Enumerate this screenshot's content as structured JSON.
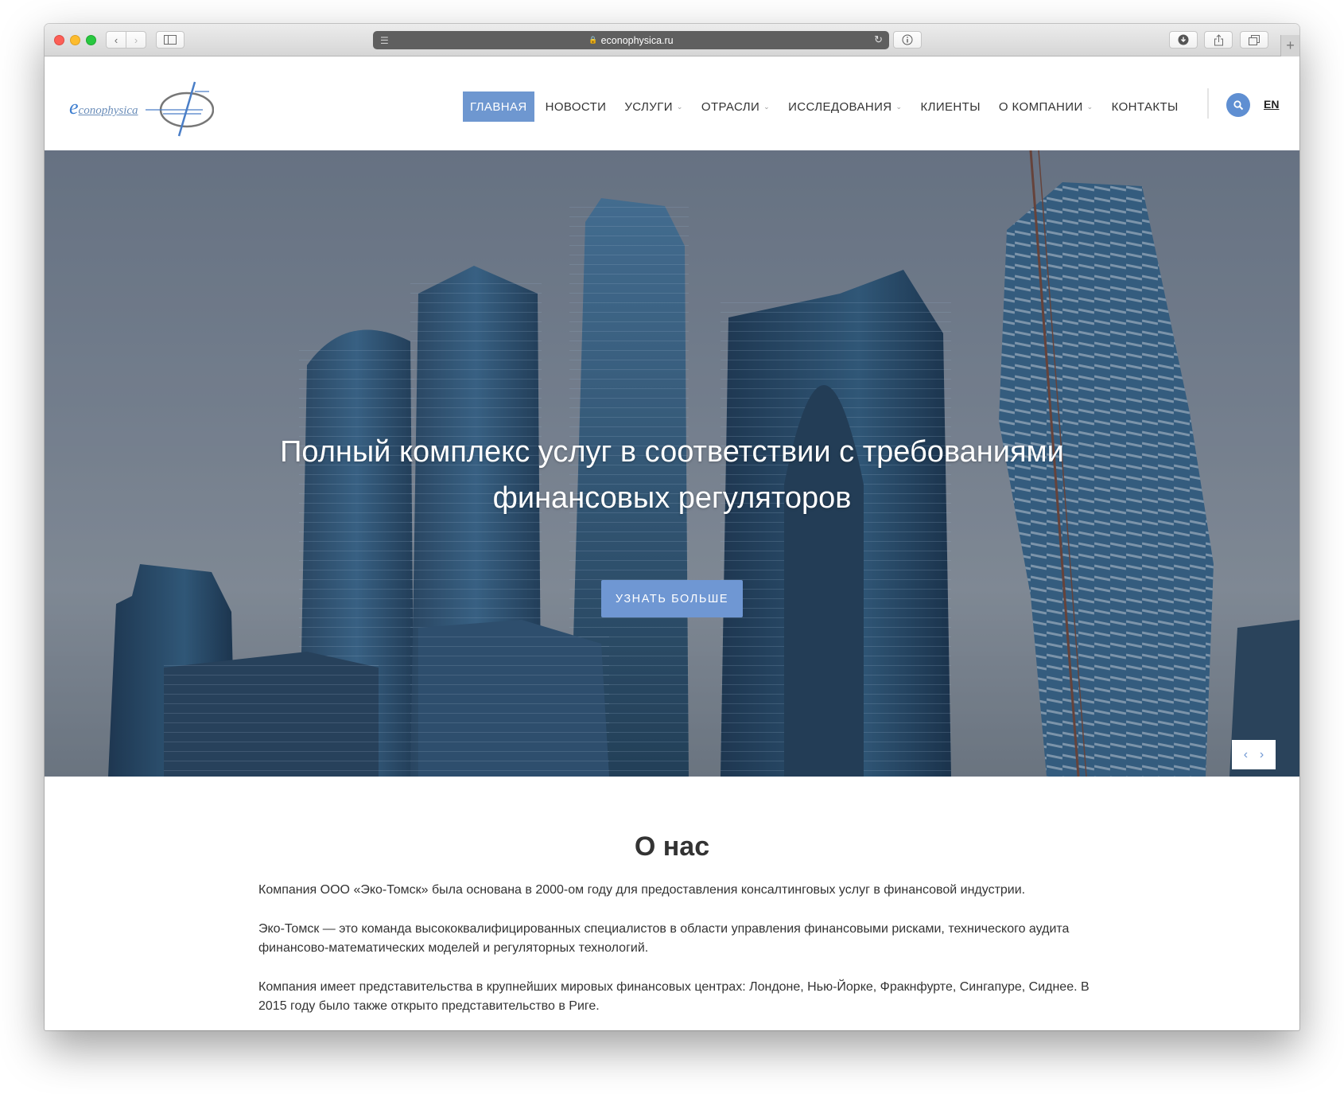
{
  "browser": {
    "url": "econophysica.ru"
  },
  "site": {
    "logo_text_initial": "e",
    "logo_text_rest": "conophysica",
    "nav": [
      {
        "label": "ГЛАВНАЯ",
        "active": true
      },
      {
        "label": "НОВОСТИ"
      },
      {
        "label": "УСЛУГИ",
        "dropdown": true
      },
      {
        "label": "ОТРАСЛИ",
        "dropdown": true
      },
      {
        "label": "ИССЛЕДОВАНИЯ",
        "dropdown": true
      },
      {
        "label": "КЛИЕНТЫ"
      },
      {
        "label": "О КОМПАНИИ",
        "dropdown": true
      },
      {
        "label": "КОНТАКТЫ"
      }
    ],
    "lang": "EN",
    "accent_color": "#6e97d0"
  },
  "hero": {
    "title": "Полный комплекс услуг в соответствии с требованиями финансовых регуляторов",
    "button": "УЗНАТЬ БОЛЬШЕ"
  },
  "about": {
    "title": "О нас",
    "paragraphs": [
      "Компания ООО «Эко-Томск» была основана в 2000-ом году для предоставления консалтинговых услуг в финансовой индустрии.",
      "Эко-Томск — это команда высококвалифицированных специалистов в области управления финансовыми рисками, технического аудита финансово-математических моделей и регуляторных технологий.",
      "Компания имеет представительства в крупнейших мировых финансовых центрах: Лондоне, Нью-Йорке, Фракнфурте, Сингапуре, Сиднее. В 2015 году было также открыто представительство в Риге."
    ]
  }
}
